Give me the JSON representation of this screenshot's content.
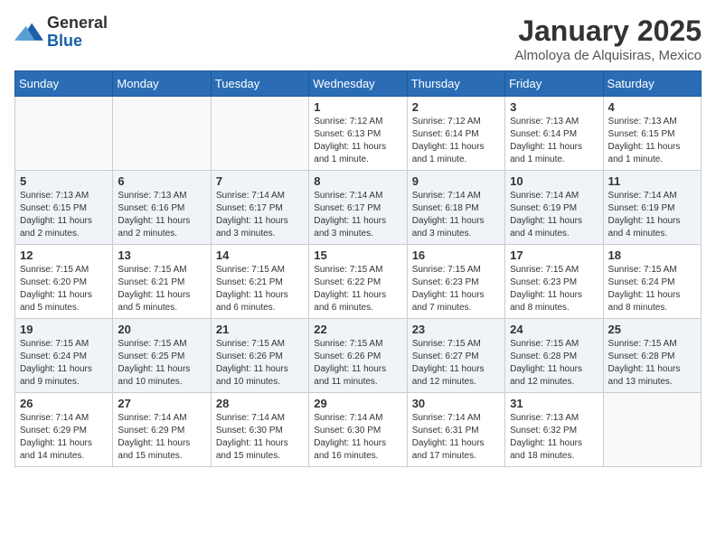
{
  "logo": {
    "general": "General",
    "blue": "Blue"
  },
  "title": {
    "month": "January 2025",
    "location": "Almoloya de Alquisiras, Mexico"
  },
  "days_of_week": [
    "Sunday",
    "Monday",
    "Tuesday",
    "Wednesday",
    "Thursday",
    "Friday",
    "Saturday"
  ],
  "weeks": [
    [
      {
        "day": "",
        "info": ""
      },
      {
        "day": "",
        "info": ""
      },
      {
        "day": "",
        "info": ""
      },
      {
        "day": "1",
        "info": "Sunrise: 7:12 AM\nSunset: 6:13 PM\nDaylight: 11 hours\nand 1 minute."
      },
      {
        "day": "2",
        "info": "Sunrise: 7:12 AM\nSunset: 6:14 PM\nDaylight: 11 hours\nand 1 minute."
      },
      {
        "day": "3",
        "info": "Sunrise: 7:13 AM\nSunset: 6:14 PM\nDaylight: 11 hours\nand 1 minute."
      },
      {
        "day": "4",
        "info": "Sunrise: 7:13 AM\nSunset: 6:15 PM\nDaylight: 11 hours\nand 1 minute."
      }
    ],
    [
      {
        "day": "5",
        "info": "Sunrise: 7:13 AM\nSunset: 6:15 PM\nDaylight: 11 hours\nand 2 minutes."
      },
      {
        "day": "6",
        "info": "Sunrise: 7:13 AM\nSunset: 6:16 PM\nDaylight: 11 hours\nand 2 minutes."
      },
      {
        "day": "7",
        "info": "Sunrise: 7:14 AM\nSunset: 6:17 PM\nDaylight: 11 hours\nand 3 minutes."
      },
      {
        "day": "8",
        "info": "Sunrise: 7:14 AM\nSunset: 6:17 PM\nDaylight: 11 hours\nand 3 minutes."
      },
      {
        "day": "9",
        "info": "Sunrise: 7:14 AM\nSunset: 6:18 PM\nDaylight: 11 hours\nand 3 minutes."
      },
      {
        "day": "10",
        "info": "Sunrise: 7:14 AM\nSunset: 6:19 PM\nDaylight: 11 hours\nand 4 minutes."
      },
      {
        "day": "11",
        "info": "Sunrise: 7:14 AM\nSunset: 6:19 PM\nDaylight: 11 hours\nand 4 minutes."
      }
    ],
    [
      {
        "day": "12",
        "info": "Sunrise: 7:15 AM\nSunset: 6:20 PM\nDaylight: 11 hours\nand 5 minutes."
      },
      {
        "day": "13",
        "info": "Sunrise: 7:15 AM\nSunset: 6:21 PM\nDaylight: 11 hours\nand 5 minutes."
      },
      {
        "day": "14",
        "info": "Sunrise: 7:15 AM\nSunset: 6:21 PM\nDaylight: 11 hours\nand 6 minutes."
      },
      {
        "day": "15",
        "info": "Sunrise: 7:15 AM\nSunset: 6:22 PM\nDaylight: 11 hours\nand 6 minutes."
      },
      {
        "day": "16",
        "info": "Sunrise: 7:15 AM\nSunset: 6:23 PM\nDaylight: 11 hours\nand 7 minutes."
      },
      {
        "day": "17",
        "info": "Sunrise: 7:15 AM\nSunset: 6:23 PM\nDaylight: 11 hours\nand 8 minutes."
      },
      {
        "day": "18",
        "info": "Sunrise: 7:15 AM\nSunset: 6:24 PM\nDaylight: 11 hours\nand 8 minutes."
      }
    ],
    [
      {
        "day": "19",
        "info": "Sunrise: 7:15 AM\nSunset: 6:24 PM\nDaylight: 11 hours\nand 9 minutes."
      },
      {
        "day": "20",
        "info": "Sunrise: 7:15 AM\nSunset: 6:25 PM\nDaylight: 11 hours\nand 10 minutes."
      },
      {
        "day": "21",
        "info": "Sunrise: 7:15 AM\nSunset: 6:26 PM\nDaylight: 11 hours\nand 10 minutes."
      },
      {
        "day": "22",
        "info": "Sunrise: 7:15 AM\nSunset: 6:26 PM\nDaylight: 11 hours\nand 11 minutes."
      },
      {
        "day": "23",
        "info": "Sunrise: 7:15 AM\nSunset: 6:27 PM\nDaylight: 11 hours\nand 12 minutes."
      },
      {
        "day": "24",
        "info": "Sunrise: 7:15 AM\nSunset: 6:28 PM\nDaylight: 11 hours\nand 12 minutes."
      },
      {
        "day": "25",
        "info": "Sunrise: 7:15 AM\nSunset: 6:28 PM\nDaylight: 11 hours\nand 13 minutes."
      }
    ],
    [
      {
        "day": "26",
        "info": "Sunrise: 7:14 AM\nSunset: 6:29 PM\nDaylight: 11 hours\nand 14 minutes."
      },
      {
        "day": "27",
        "info": "Sunrise: 7:14 AM\nSunset: 6:29 PM\nDaylight: 11 hours\nand 15 minutes."
      },
      {
        "day": "28",
        "info": "Sunrise: 7:14 AM\nSunset: 6:30 PM\nDaylight: 11 hours\nand 15 minutes."
      },
      {
        "day": "29",
        "info": "Sunrise: 7:14 AM\nSunset: 6:30 PM\nDaylight: 11 hours\nand 16 minutes."
      },
      {
        "day": "30",
        "info": "Sunrise: 7:14 AM\nSunset: 6:31 PM\nDaylight: 11 hours\nand 17 minutes."
      },
      {
        "day": "31",
        "info": "Sunrise: 7:13 AM\nSunset: 6:32 PM\nDaylight: 11 hours\nand 18 minutes."
      },
      {
        "day": "",
        "info": ""
      }
    ]
  ]
}
